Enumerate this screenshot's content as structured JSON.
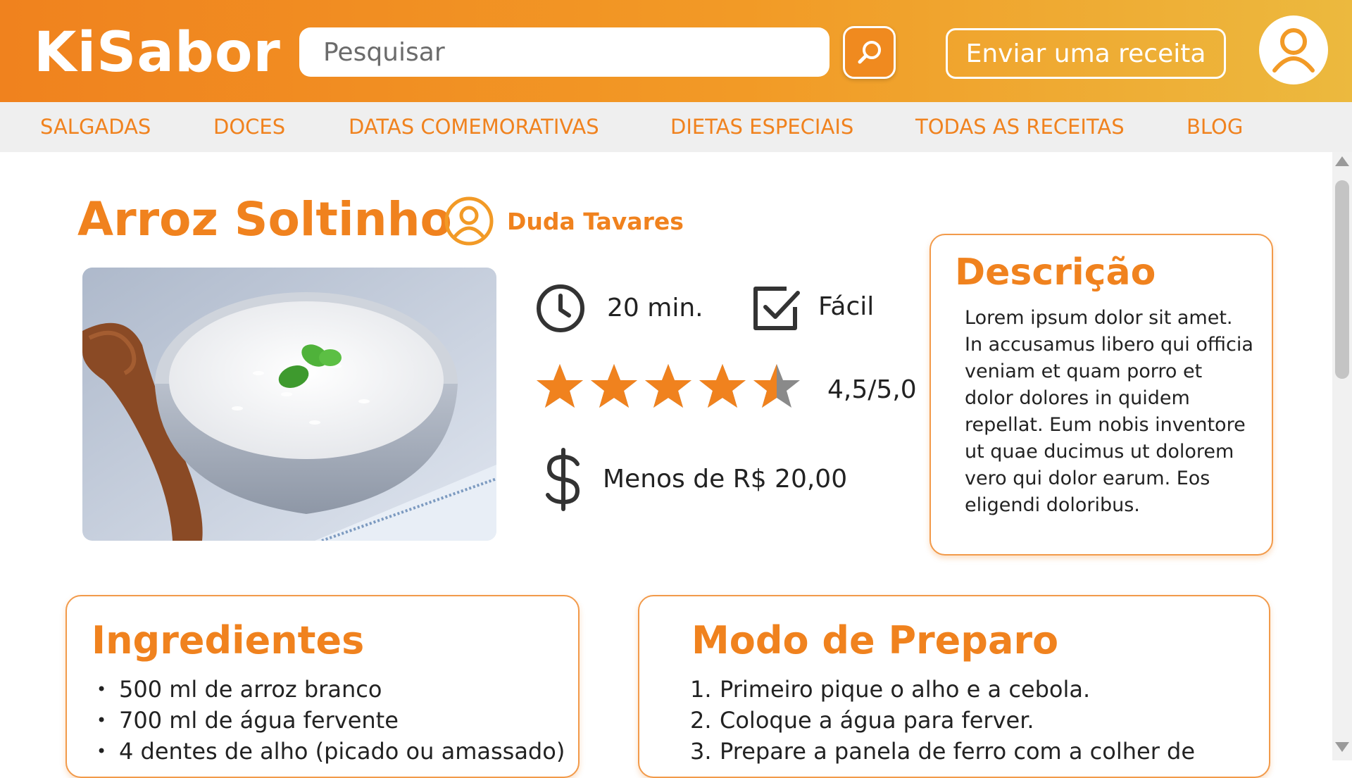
{
  "header": {
    "logo": "KiSabor",
    "search_placeholder": "Pesquisar",
    "submit_recipe_label": "Enviar uma receita"
  },
  "nav": {
    "items": [
      {
        "label": "SALGADAS"
      },
      {
        "label": "DOCES"
      },
      {
        "label": "DATAS COMEMORATIVAS"
      },
      {
        "label": "DIETAS ESPECIAIS"
      },
      {
        "label": "TODAS AS RECEITAS"
      },
      {
        "label": "BLOG"
      }
    ]
  },
  "recipe": {
    "title": "Arroz Soltinho",
    "author": "Duda Tavares",
    "time": "20 min.",
    "difficulty": "Fácil",
    "rating_text": "4,5/5,0",
    "rating_value": 4.5,
    "rating_max": 5,
    "cost": "Menos de R$ 20,00"
  },
  "description": {
    "title": "Descrição",
    "text": "Lorem ipsum dolor sit amet. In accusamus libero qui officia veniam et quam porro et dolor dolores in quidem repellat. Eum nobis inventore ut quae ducimus ut dolorem vero qui dolor earum. Eos eligendi doloribus."
  },
  "ingredients": {
    "title": "Ingredientes",
    "items": [
      "500 ml de arroz branco",
      "700 ml de água fervente",
      "4 dentes de alho (picado ou amassado)"
    ]
  },
  "preparation": {
    "title": "Modo de Preparo",
    "steps": [
      "Primeiro pique o alho e a cebola.",
      "Coloque a água para ferver.",
      "Prepare a panela de ferro com a colher de"
    ]
  },
  "colors": {
    "accent": "#f0821e",
    "header_gradient_end": "#ecb93e",
    "star_empty": "#8a8a8a",
    "nav_background": "#efefef"
  },
  "icons": {
    "search": "search-icon",
    "user": "user-icon",
    "clock": "clock-icon",
    "checkbox": "checkbox-icon",
    "dollar": "dollar-icon",
    "star": "star-icon"
  }
}
